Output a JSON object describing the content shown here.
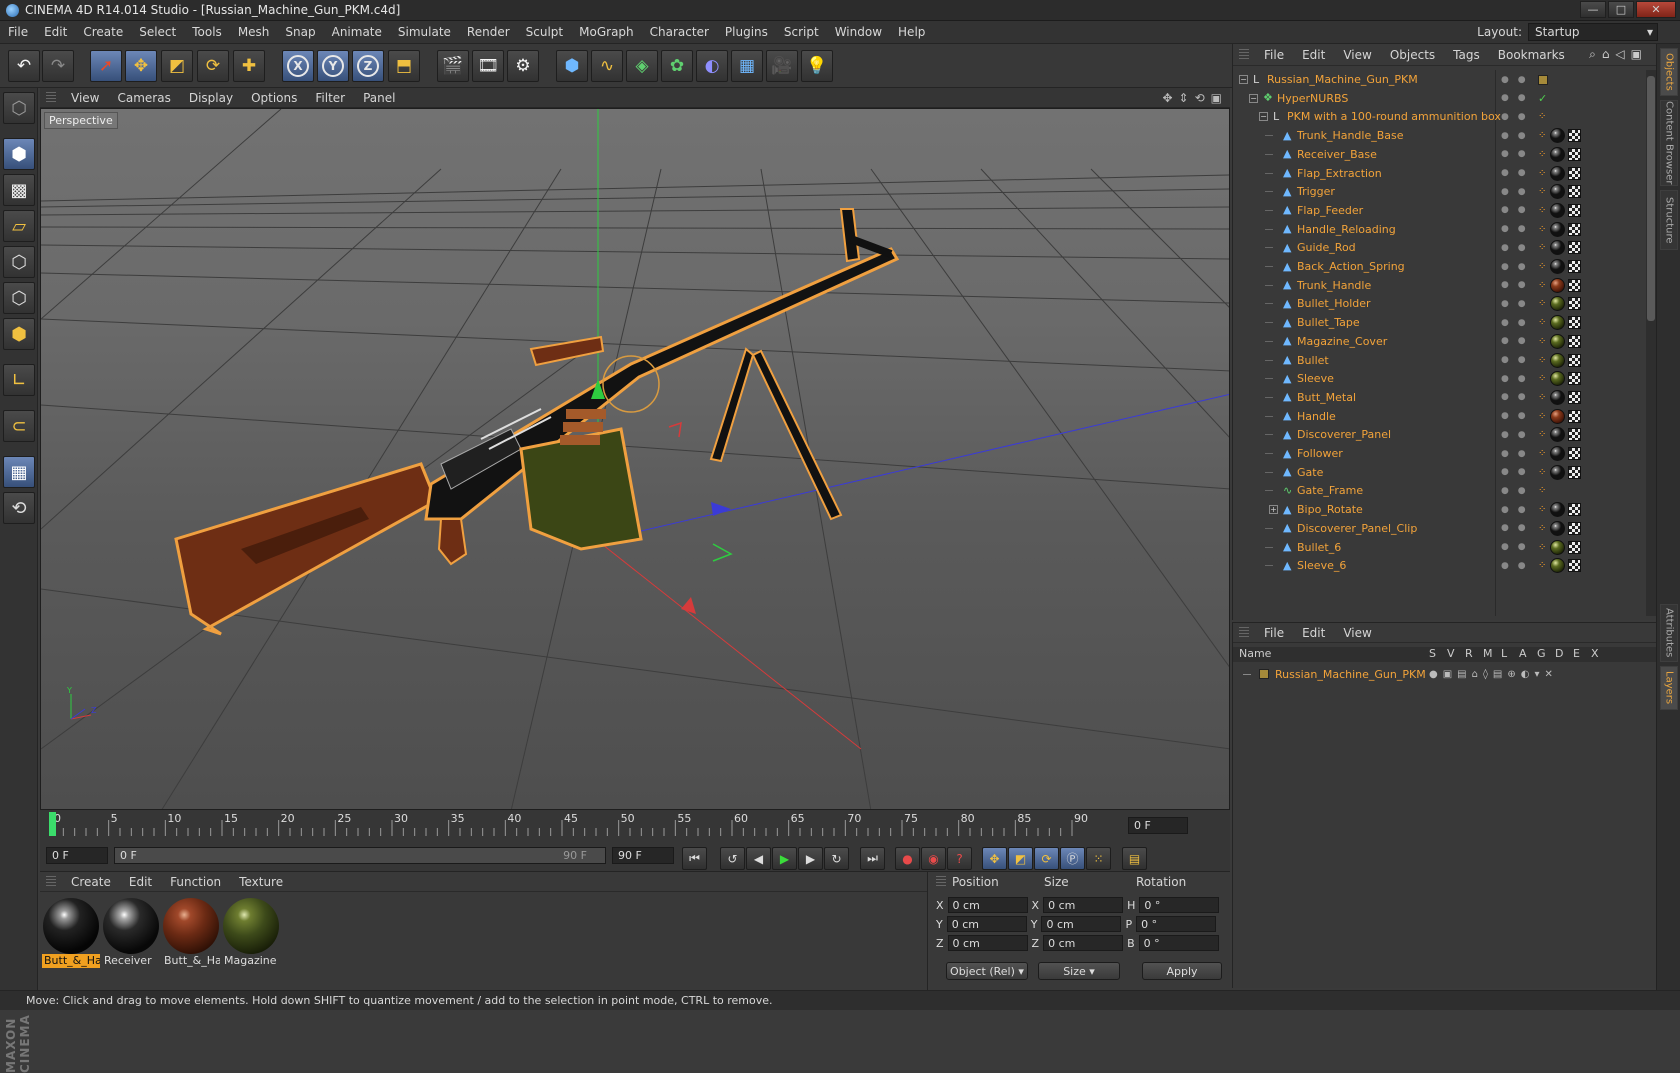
{
  "window": {
    "title": "CINEMA 4D R14.014 Studio - [Russian_Machine_Gun_PKM.c4d]",
    "buttons": [
      "—",
      "□",
      "✕"
    ]
  },
  "menubar": [
    "File",
    "Edit",
    "Create",
    "Select",
    "Tools",
    "Mesh",
    "Snap",
    "Animate",
    "Simulate",
    "Render",
    "Sculpt",
    "MoGraph",
    "Character",
    "Plugins",
    "Script",
    "Window",
    "Help"
  ],
  "layout": {
    "label": "Layout:",
    "value": "Startup"
  },
  "toolbar_icons": [
    "undo-icon",
    "redo-icon",
    "live-selection-icon",
    "move-icon",
    "scale-icon",
    "rotate-icon",
    "create-icon",
    "x-axis-lock",
    "y-axis-lock",
    "z-axis-lock",
    "coordinate-system-icon",
    "render-view-icon",
    "render-picture-viewer-icon",
    "render-settings-icon",
    "cube-icon",
    "spline-icon",
    "nurbs-icon",
    "array-icon",
    "deformer-icon",
    "floor-icon",
    "camera-icon",
    "light-icon"
  ],
  "axis_labels": [
    "X",
    "Y",
    "Z"
  ],
  "viewport": {
    "menu": [
      "View",
      "Cameras",
      "Display",
      "Options",
      "Filter",
      "Panel"
    ],
    "label": "Perspective",
    "icons": [
      "move-view-icon",
      "scroll-view-icon",
      "rotate-view-icon",
      "maximize-view-icon"
    ]
  },
  "timeline": {
    "ticks": [
      0,
      5,
      10,
      15,
      20,
      25,
      30,
      35,
      40,
      45,
      50,
      55,
      60,
      65,
      70,
      75,
      80,
      85,
      90
    ],
    "current_frame": "0 F"
  },
  "playbar": {
    "start": "0 F",
    "range_start": "0 F",
    "range_end": "90 F",
    "end": "90 F"
  },
  "material_manager": {
    "menu": [
      "Create",
      "Edit",
      "Function",
      "Texture"
    ],
    "materials": [
      {
        "name": "Butt_&_Ha",
        "selected": true,
        "color": "#111111"
      },
      {
        "name": "Receiver",
        "selected": false,
        "color": "#151515"
      },
      {
        "name": "Butt_&_Ha",
        "selected": false,
        "color": "#6b2a14"
      },
      {
        "name": "Magazine",
        "selected": false,
        "color": "#3d4a1a"
      }
    ]
  },
  "attributes": {
    "headers": [
      "Position",
      "Size",
      "Rotation"
    ],
    "rows": [
      {
        "a": "X",
        "pos": "0 cm",
        "b": "X",
        "size": "0 cm",
        "c": "H",
        "rot": "0 °"
      },
      {
        "a": "Y",
        "pos": "0 cm",
        "b": "Y",
        "size": "0 cm",
        "c": "P",
        "rot": "0 °"
      },
      {
        "a": "Z",
        "pos": "0 cm",
        "b": "Z",
        "size": "0 cm",
        "c": "B",
        "rot": "0 °"
      }
    ],
    "mode": "Object (Rel)",
    "size_mode": "Size",
    "apply": "Apply"
  },
  "status": "Move: Click and drag to move elements. Hold down SHIFT to quantize movement / add to the selection in point mode, CTRL to remove.",
  "object_manager": {
    "menu": [
      "File",
      "Edit",
      "View",
      "Objects",
      "Tags",
      "Bookmarks"
    ],
    "objects": [
      {
        "name": "Russian_Machine_Gun_PKM",
        "level": 0,
        "icon": "null",
        "tags": "layer"
      },
      {
        "name": "HyperNURBS",
        "level": 1,
        "icon": "nurbs",
        "tags": "none"
      },
      {
        "name": "PKM with a 100-round ammunition box",
        "level": 2,
        "icon": "null",
        "tags": "none"
      },
      {
        "name": "Trunk_Handle_Base",
        "level": 3,
        "icon": "poly",
        "tags": "black"
      },
      {
        "name": "Receiver_Base",
        "level": 3,
        "icon": "poly",
        "tags": "black"
      },
      {
        "name": "Flap_Extraction",
        "level": 3,
        "icon": "poly",
        "tags": "black"
      },
      {
        "name": "Trigger",
        "level": 3,
        "icon": "poly",
        "tags": "black"
      },
      {
        "name": "Flap_Feeder",
        "level": 3,
        "icon": "poly",
        "tags": "black"
      },
      {
        "name": "Handle_Reloading",
        "level": 3,
        "icon": "poly",
        "tags": "black"
      },
      {
        "name": "Guide_Rod",
        "level": 3,
        "icon": "poly",
        "tags": "black"
      },
      {
        "name": "Back_Action_Spring",
        "level": 3,
        "icon": "poly",
        "tags": "black"
      },
      {
        "name": "Trunk_Handle",
        "level": 3,
        "icon": "poly",
        "tags": "wood"
      },
      {
        "name": "Bullet_Holder",
        "level": 3,
        "icon": "poly",
        "tags": "olive"
      },
      {
        "name": "Bullet_Tape",
        "level": 3,
        "icon": "poly",
        "tags": "olive"
      },
      {
        "name": "Magazine_Cover",
        "level": 3,
        "icon": "poly",
        "tags": "olive"
      },
      {
        "name": "Bullet",
        "level": 3,
        "icon": "poly",
        "tags": "olive"
      },
      {
        "name": "Sleeve",
        "level": 3,
        "icon": "poly",
        "tags": "olive"
      },
      {
        "name": "Butt_Metal",
        "level": 3,
        "icon": "poly",
        "tags": "black"
      },
      {
        "name": "Handle",
        "level": 3,
        "icon": "poly",
        "tags": "wood"
      },
      {
        "name": "Discoverer_Panel",
        "level": 3,
        "icon": "poly",
        "tags": "black"
      },
      {
        "name": "Follower",
        "level": 3,
        "icon": "poly",
        "tags": "black"
      },
      {
        "name": "Gate",
        "level": 3,
        "icon": "poly",
        "tags": "black"
      },
      {
        "name": "Gate_Frame",
        "level": 3,
        "icon": "spline",
        "tags": "orange"
      },
      {
        "name": "Bipo_Rotate",
        "level": 3,
        "icon": "poly",
        "tags": "black",
        "expand": true
      },
      {
        "name": "Discoverer_Panel_Clip",
        "level": 3,
        "icon": "poly",
        "tags": "black"
      },
      {
        "name": "Bullet_6",
        "level": 3,
        "icon": "poly",
        "tags": "olive"
      },
      {
        "name": "Sleeve_6",
        "level": 3,
        "icon": "poly",
        "tags": "olive"
      }
    ]
  },
  "layer_manager": {
    "menu": [
      "File",
      "Edit",
      "View"
    ],
    "columns": [
      "Name",
      "S",
      "V",
      "R",
      "M",
      "L",
      "A",
      "G",
      "D",
      "E",
      "X"
    ],
    "layers": [
      {
        "name": "Russian_Machine_Gun_PKM"
      }
    ]
  },
  "right_tabs": [
    "Objects",
    "Content Browser",
    "Structure",
    "Attributes",
    "Layers"
  ],
  "branding": "MAXON CINEMA 4D",
  "colors": {
    "accent": "#f2a33a",
    "selected_tool": "#5d7aad",
    "viewport": "#6a6a6a"
  }
}
